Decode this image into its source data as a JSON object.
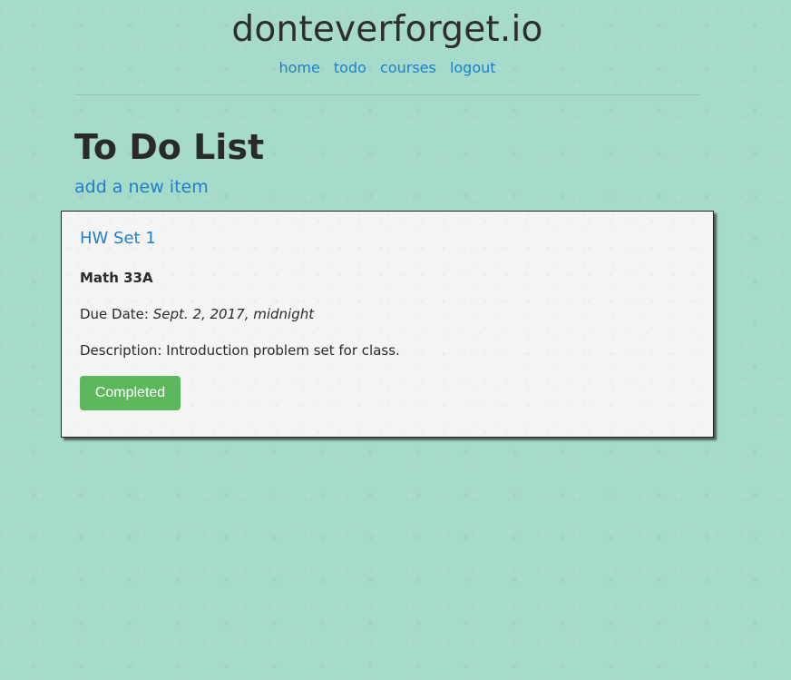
{
  "header": {
    "site_title": "donteverforget.io",
    "nav": [
      {
        "label": "home"
      },
      {
        "label": "todo"
      },
      {
        "label": "courses"
      },
      {
        "label": "logout"
      }
    ]
  },
  "main": {
    "page_title": "To Do List",
    "add_link_label": "add a new item",
    "items": [
      {
        "title": "HW Set 1",
        "course": "Math 33A",
        "due_label": "Due Date:",
        "due_value": "Sept. 2, 2017, midnight",
        "description_label": "Description:",
        "description_value": "Introduction problem set for class.",
        "status_button_label": "Completed"
      }
    ]
  },
  "colors": {
    "background": "#a6dacb",
    "link": "#1f7fc9",
    "card_background": "#f4f4f4",
    "success_button": "#5cb85c"
  }
}
